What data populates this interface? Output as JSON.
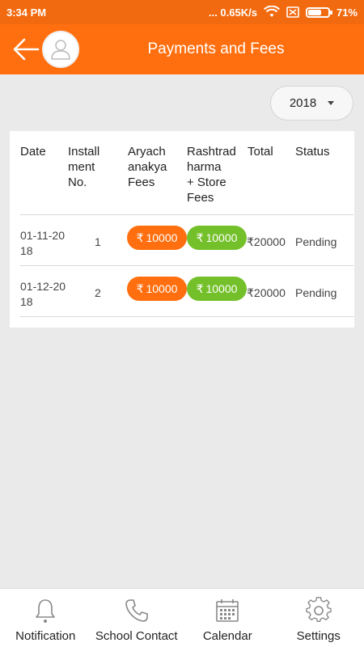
{
  "status_bar": {
    "time": "3:34 PM",
    "network_speed": "... 0.65K/s",
    "battery_percent": "71%",
    "battery_level": 0.71
  },
  "app_bar": {
    "title": "Payments and Fees",
    "back_icon": "arrow-left-icon",
    "avatar_icon": "user-icon"
  },
  "year_selector": {
    "value": "2018"
  },
  "table": {
    "headers": {
      "date": [
        "Date"
      ],
      "installment": [
        "Install",
        "ment",
        "No."
      ],
      "fee1": [
        "Aryach",
        "anakya",
        "Fees"
      ],
      "fee2": [
        "Rashtrad",
        "harma",
        "+ Store",
        "Fees"
      ],
      "total": [
        "Total"
      ],
      "status": [
        "Status"
      ]
    },
    "rows": [
      {
        "date": [
          "01-11-20",
          "18"
        ],
        "installment_no": "1",
        "fee1": "10000",
        "fee2": "10000",
        "total": "20000",
        "status": "Pending"
      },
      {
        "date": [
          "01-12-20",
          "18"
        ],
        "installment_no": "2",
        "fee1": "10000",
        "fee2": "10000",
        "total": "20000",
        "status": "Pending"
      }
    ],
    "currency_symbol": "₹"
  },
  "bottom_nav": [
    {
      "label": "Notification",
      "icon": "bell-icon"
    },
    {
      "label": "School Contact",
      "icon": "phone-icon"
    },
    {
      "label": "Calendar",
      "icon": "calendar-icon"
    },
    {
      "label": "Settings",
      "icon": "gear-icon"
    }
  ],
  "colors": {
    "accent": "#ff6f0f",
    "paid_green": "#74c02a",
    "background": "#ebeaea"
  }
}
